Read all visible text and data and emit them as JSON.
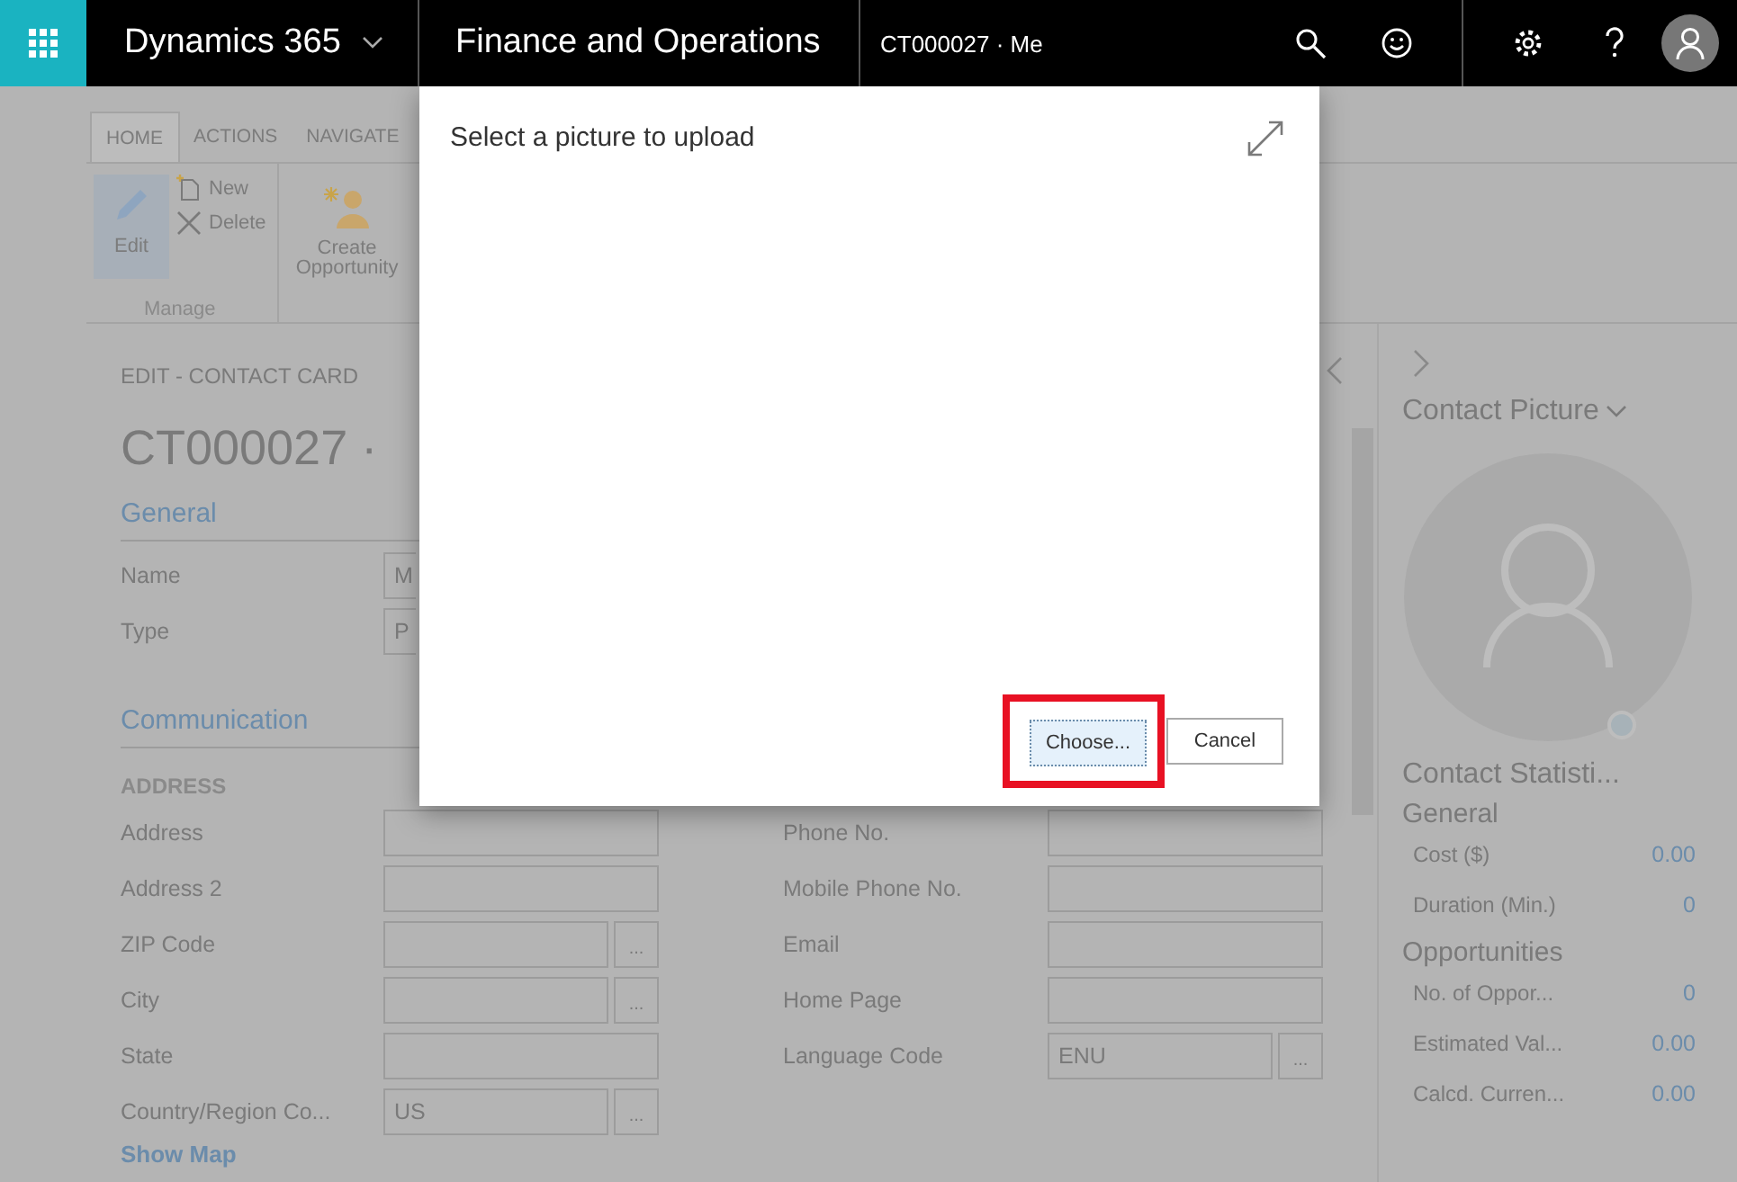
{
  "topbar": {
    "product": "Dynamics 365",
    "module": "Finance and Operations",
    "record": "CT000027 · Me"
  },
  "ribbon": {
    "tabs": [
      {
        "label": "HOME",
        "selected": true
      },
      {
        "label": "ACTIONS",
        "selected": false
      },
      {
        "label": "NAVIGATE",
        "selected": false
      }
    ],
    "edit": {
      "label": "Edit",
      "selected": true
    },
    "new": "New",
    "delete": "Delete",
    "group_label": "Manage",
    "create_opportunity": "Create Opportunity"
  },
  "form": {
    "caption": "EDIT - CONTACT CARD",
    "title": "CT000027 ·",
    "general": {
      "title": "General",
      "rows": [
        {
          "label": "Name",
          "value": "M"
        },
        {
          "label": "Type",
          "value": "P"
        }
      ]
    },
    "communication": {
      "title": "Communication",
      "subheading": "ADDRESS",
      "left": [
        {
          "label": "Address",
          "lookup": false
        },
        {
          "label": "Address 2",
          "lookup": false
        },
        {
          "label": "ZIP Code",
          "lookup": true
        },
        {
          "label": "City",
          "lookup": true
        },
        {
          "label": "State",
          "lookup": false
        },
        {
          "label": "Country/Region Co...",
          "value": "US",
          "lookup": true
        }
      ],
      "right": [
        {
          "label": "Phone No.",
          "lookup": false
        },
        {
          "label": "Mobile Phone No.",
          "lookup": false
        },
        {
          "label": "Email",
          "lookup": false
        },
        {
          "label": "Home Page",
          "lookup": false
        },
        {
          "label": "Language Code",
          "value": "ENU",
          "lookup": true
        }
      ],
      "lookup_button": "...",
      "show_map": "Show Map"
    }
  },
  "factbox": {
    "picture_title": "Contact Picture",
    "stats_title": "Contact Statisti...",
    "groups": [
      {
        "title": "General",
        "items": [
          {
            "label": "Cost ($)",
            "value": "0.00"
          },
          {
            "label": "Duration (Min.)",
            "value": "0"
          }
        ]
      },
      {
        "title": "Opportunities",
        "items": [
          {
            "label": "No. of Oppor...",
            "value": "0"
          },
          {
            "label": "Estimated Val...",
            "value": "0.00"
          },
          {
            "label": "Calcd. Curren...",
            "value": "0.00"
          }
        ]
      }
    ]
  },
  "dialog": {
    "title": "Select a picture to upload",
    "buttons": [
      {
        "label": "Choose...",
        "focused": true,
        "highlighted": true
      },
      {
        "label": "Cancel",
        "focused": false,
        "highlighted": false
      }
    ]
  }
}
